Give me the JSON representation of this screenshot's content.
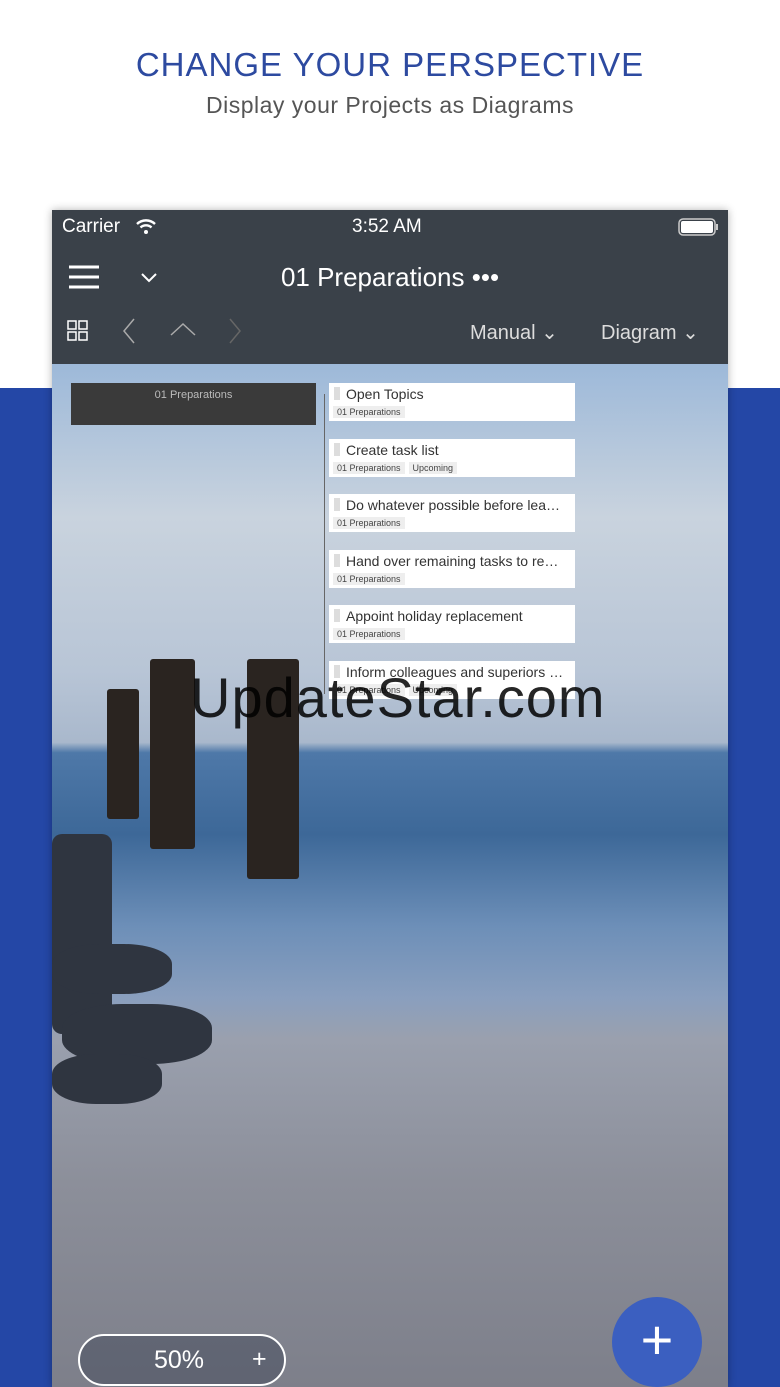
{
  "promo": {
    "headline": "CHANGE YOUR PERSPECTIVE",
    "subtitle": "Display your Projects as Diagrams"
  },
  "status_bar": {
    "carrier": "Carrier",
    "time": "3:52 AM"
  },
  "nav": {
    "title": "01 Preparations",
    "more": "•••"
  },
  "toolbar": {
    "sort": "Manual",
    "view": "Diagram"
  },
  "diagram": {
    "root": "01 Preparations",
    "tasks": [
      {
        "title": "Open Topics",
        "tags": [
          "01 Preparations"
        ]
      },
      {
        "title": "Create task list",
        "tags": [
          "01 Preparations",
          "Upcoming"
        ]
      },
      {
        "title": "Do whatever possible before lea…",
        "tags": [
          "01 Preparations"
        ]
      },
      {
        "title": "Hand over remaining tasks to re…",
        "tags": [
          "01 Preparations"
        ]
      },
      {
        "title": "Appoint holiday replacement",
        "tags": [
          "01 Preparations"
        ]
      },
      {
        "title": "Inform colleagues and superiors …",
        "tags": [
          "01 Preparations",
          "Upcoming"
        ]
      }
    ]
  },
  "zoom": {
    "level": "50%",
    "plus": "+"
  },
  "fab": "+",
  "watermark": "UpdateStar.com"
}
